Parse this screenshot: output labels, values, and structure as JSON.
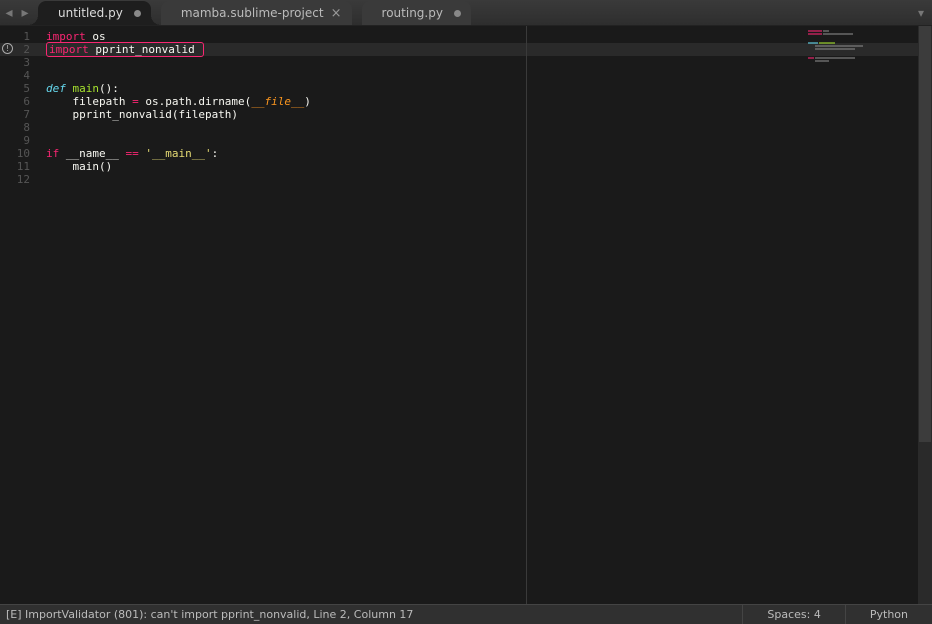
{
  "tabs": [
    {
      "label": "untitled.py",
      "dirty": true,
      "active": true
    },
    {
      "label": "mamba.sublime-project",
      "dirty": false,
      "active": false
    },
    {
      "label": "routing.py",
      "dirty": true,
      "active": false
    }
  ],
  "gutter": {
    "lines": [
      "1",
      "2",
      "3",
      "4",
      "5",
      "6",
      "7",
      "8",
      "9",
      "10",
      "11",
      "12"
    ],
    "error_line": 2,
    "error_glyph": "!"
  },
  "code": {
    "l1": {
      "kw": "import",
      "mod": "os"
    },
    "l2": {
      "kw": "import",
      "mod": "pprint_nonvalid"
    },
    "l5": {
      "kw": "def",
      "name": "main",
      "paren": "():"
    },
    "l6": {
      "indent": "    filepath ",
      "op": "=",
      "rest": " os.path.dirname(",
      "var": "__file__",
      "close": ")"
    },
    "l7": {
      "indent": "    pprint_nonvalid(filepath)"
    },
    "l10": {
      "kw": "if",
      "var": " __name__ ",
      "op": "==",
      "str": " '__main__'",
      "colon": ":"
    },
    "l11": {
      "indent": "    main()"
    }
  },
  "status": {
    "message": "[E] ImportValidator (801): can't import pprint_nonvalid, Line 2, Column 17",
    "spaces": "Spaces: 4",
    "language": "Python"
  }
}
